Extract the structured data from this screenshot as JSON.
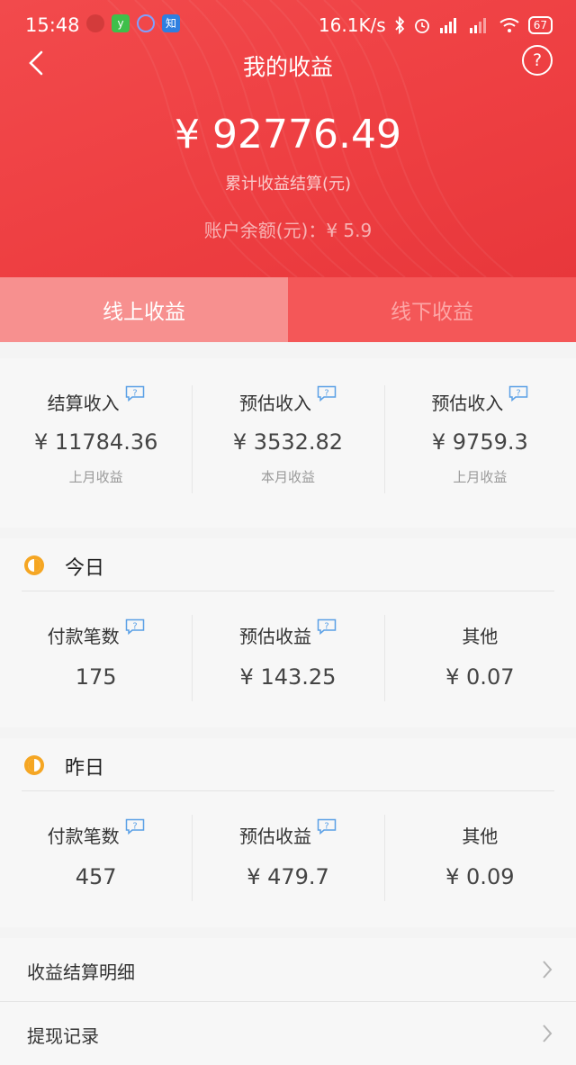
{
  "status_bar": {
    "time": "15:48",
    "net_speed": "16.1K/s",
    "battery": "67",
    "app_icons": [
      {
        "icon": "shield-app-icon",
        "label": "",
        "color": "#d33b3b"
      },
      {
        "icon": "y-app-icon",
        "label": "y",
        "color": "#3fbf4a"
      },
      {
        "icon": "circle-app-icon",
        "label": "",
        "color": "#5f7ff0"
      },
      {
        "icon": "zhihu-app-icon",
        "label": "知",
        "color": "#2f7fe0"
      }
    ]
  },
  "nav": {
    "title": "我的收益",
    "help_symbol": "?"
  },
  "summary": {
    "total": "¥ 92776.49",
    "total_label": "累计收益结算(元)",
    "balance": "账户余额(元)：¥ 5.9"
  },
  "tabs": [
    {
      "label": "线上收益",
      "active": true
    },
    {
      "label": "线下收益",
      "active": false
    }
  ],
  "overview": [
    {
      "title": "结算收入",
      "value": "¥ 11784.36",
      "sub": "上月收益",
      "help": true
    },
    {
      "title": "预估收入",
      "value": "¥ 3532.82",
      "sub": "本月收益",
      "help": true
    },
    {
      "title": "预估收入",
      "value": "¥ 9759.3",
      "sub": "上月收益",
      "help": true
    }
  ],
  "today": {
    "title": "今日",
    "items": [
      {
        "title": "付款笔数",
        "value": "175",
        "help": true
      },
      {
        "title": "预估收益",
        "value": "¥ 143.25",
        "help": true
      },
      {
        "title": "其他",
        "value": "¥ 0.07",
        "help": false
      }
    ]
  },
  "yesterday": {
    "title": "昨日",
    "items": [
      {
        "title": "付款笔数",
        "value": "457",
        "help": true
      },
      {
        "title": "预估收益",
        "value": "¥ 479.7",
        "help": true
      },
      {
        "title": "其他",
        "value": "¥ 0.09",
        "help": false
      }
    ]
  },
  "links": [
    {
      "label": "收益结算明细"
    },
    {
      "label": "提现记录"
    }
  ],
  "colors": {
    "header_red": "#ee3f42",
    "sun_orange": "#f5a623",
    "help_blue": "#5aa0e6"
  }
}
